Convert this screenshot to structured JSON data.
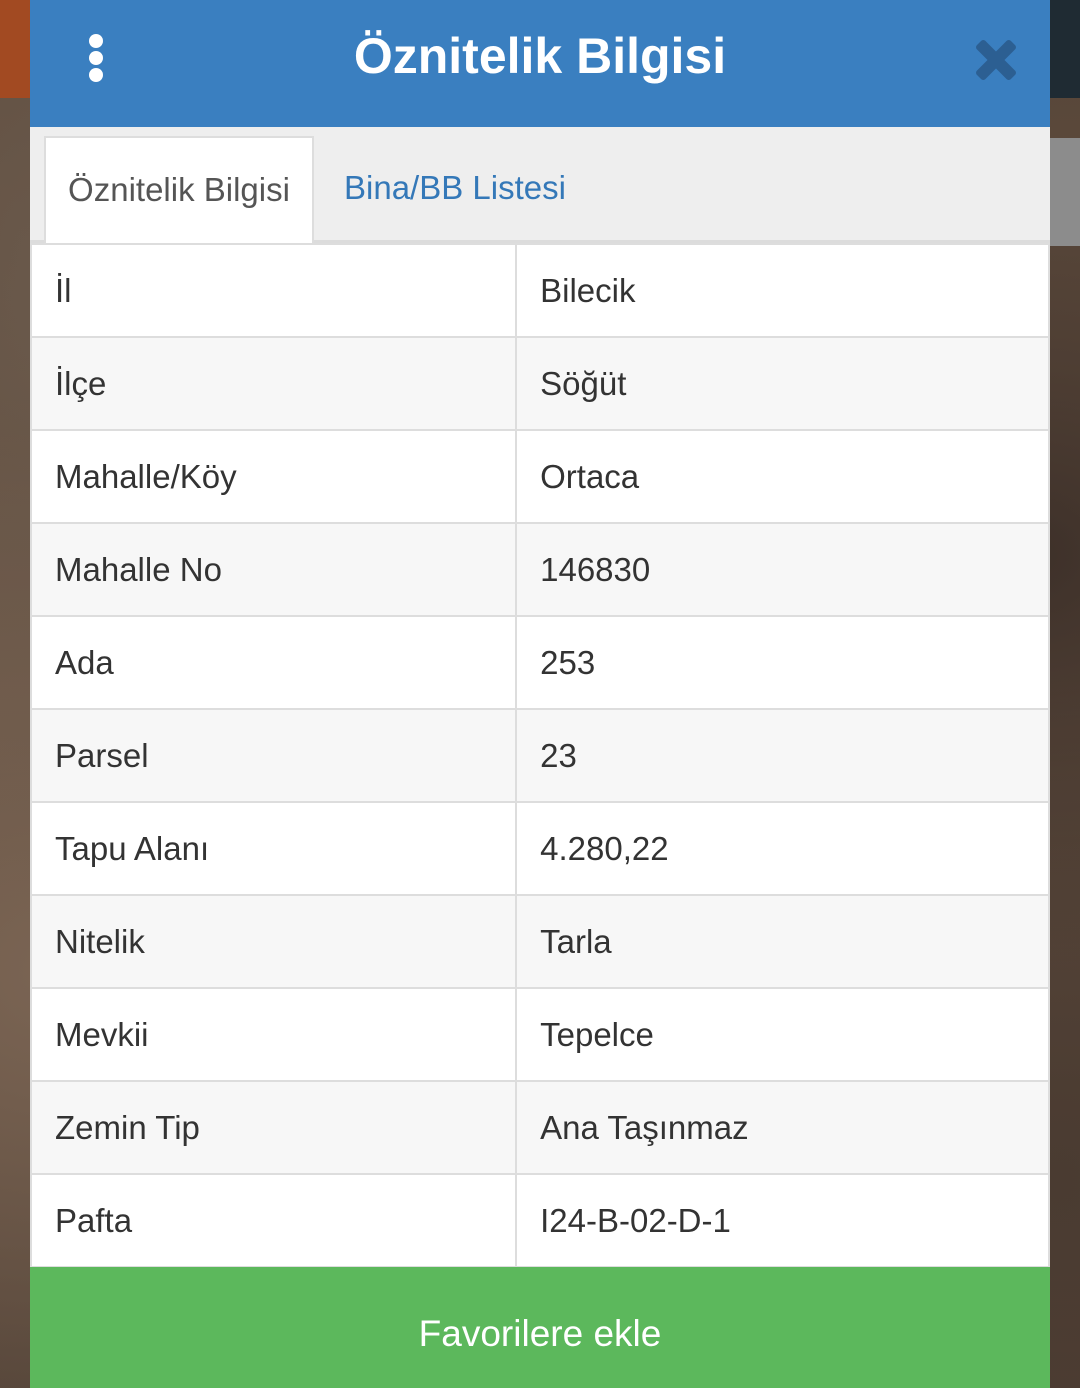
{
  "modal": {
    "title": "Öznitelik Bilgisi"
  },
  "tabs": [
    {
      "label": "Öznitelik Bilgisi",
      "active": true
    },
    {
      "label": "Bina/BB Listesi",
      "active": false
    }
  ],
  "attributes": [
    {
      "key": "İl",
      "value": "Bilecik"
    },
    {
      "key": "İlçe",
      "value": "Söğüt"
    },
    {
      "key": "Mahalle/Köy",
      "value": "Ortaca"
    },
    {
      "key": "Mahalle No",
      "value": "146830"
    },
    {
      "key": "Ada",
      "value": "253"
    },
    {
      "key": "Parsel",
      "value": "23"
    },
    {
      "key": "Tapu Alanı",
      "value": "4.280,22"
    },
    {
      "key": "Nitelik",
      "value": "Tarla"
    },
    {
      "key": "Mevkii",
      "value": "Tepelce"
    },
    {
      "key": "Zemin Tip",
      "value": "Ana Taşınmaz"
    },
    {
      "key": "Pafta",
      "value": "I24-B-02-D-1"
    }
  ],
  "footer": {
    "favorite_label": "Favorilere ekle"
  },
  "colors": {
    "header": "#3a7fc0",
    "tab_link": "#3478b8",
    "favorite_button": "#5cb85c"
  },
  "icons": {
    "menu": "vertical-dots-icon",
    "close": "close-icon"
  }
}
